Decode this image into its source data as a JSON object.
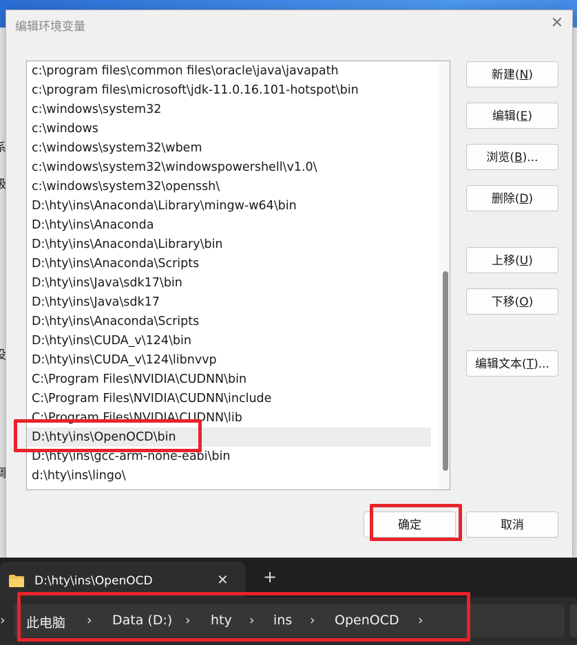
{
  "dialog": {
    "title": "编辑环境变量",
    "paths": [
      "c:\\program files\\common files\\oracle\\java\\javapath",
      "c:\\program files\\microsoft\\jdk-11.0.16.101-hotspot\\bin",
      "c:\\windows\\system32",
      "c:\\windows",
      "c:\\windows\\system32\\wbem",
      "c:\\windows\\system32\\windowspowershell\\v1.0\\",
      "c:\\windows\\system32\\openssh\\",
      "D:\\hty\\ins\\Anaconda\\Library\\mingw-w64\\bin",
      "D:\\hty\\ins\\Anaconda",
      "D:\\hty\\ins\\Anaconda\\Library\\bin",
      "D:\\hty\\ins\\Anaconda\\Scripts",
      "D:\\hty\\ins\\Java\\sdk17\\bin",
      "D:\\hty\\ins\\Java\\sdk17",
      "D:\\hty\\ins\\Anaconda\\Scripts",
      "D:\\hty\\ins\\CUDA_v\\124\\bin",
      "D:\\hty\\ins\\CUDA_v\\124\\libnvvp",
      "C:\\Program Files\\NVIDIA\\CUDNN\\bin",
      "C:\\Program Files\\NVIDIA\\CUDNN\\include",
      "C:\\Program Files\\NVIDIA\\CUDNN\\lib",
      "D:\\hty\\ins\\OpenOCD\\bin",
      "D:\\hty\\ins\\gcc-arm-none-eabi\\bin",
      "d:\\hty\\ins\\lingo\\"
    ],
    "selected_index": 19,
    "buttons": {
      "new": {
        "label": "新建(",
        "key": "N",
        "end": ")"
      },
      "edit": {
        "label": "编辑(",
        "key": "E",
        "end": ")"
      },
      "browse": {
        "label": "浏览(",
        "key": "B",
        "end": ")..."
      },
      "delete": {
        "label": "删除(",
        "key": "D",
        "end": ")"
      },
      "move_up": {
        "label": "上移(",
        "key": "U",
        "end": ")"
      },
      "move_down": {
        "label": "下移(",
        "key": "O",
        "end": ")"
      },
      "edit_text": {
        "label": "编辑文本(",
        "key": "T",
        "end": ")..."
      },
      "ok": "确定",
      "cancel": "取消"
    }
  },
  "background_chars": [
    "系",
    "级",
    "没",
    "调"
  ],
  "explorer": {
    "tab_title": "D:\\hty\\ins\\OpenOCD",
    "tab_close": "✕",
    "new_tab": "+",
    "breadcrumb": [
      "此电脑",
      "Data (D:)",
      "hty",
      "ins",
      "OpenOCD"
    ],
    "chevron": "›"
  },
  "colors": {
    "highlight_box": "#e8232b",
    "folder": "#f2c14e"
  }
}
